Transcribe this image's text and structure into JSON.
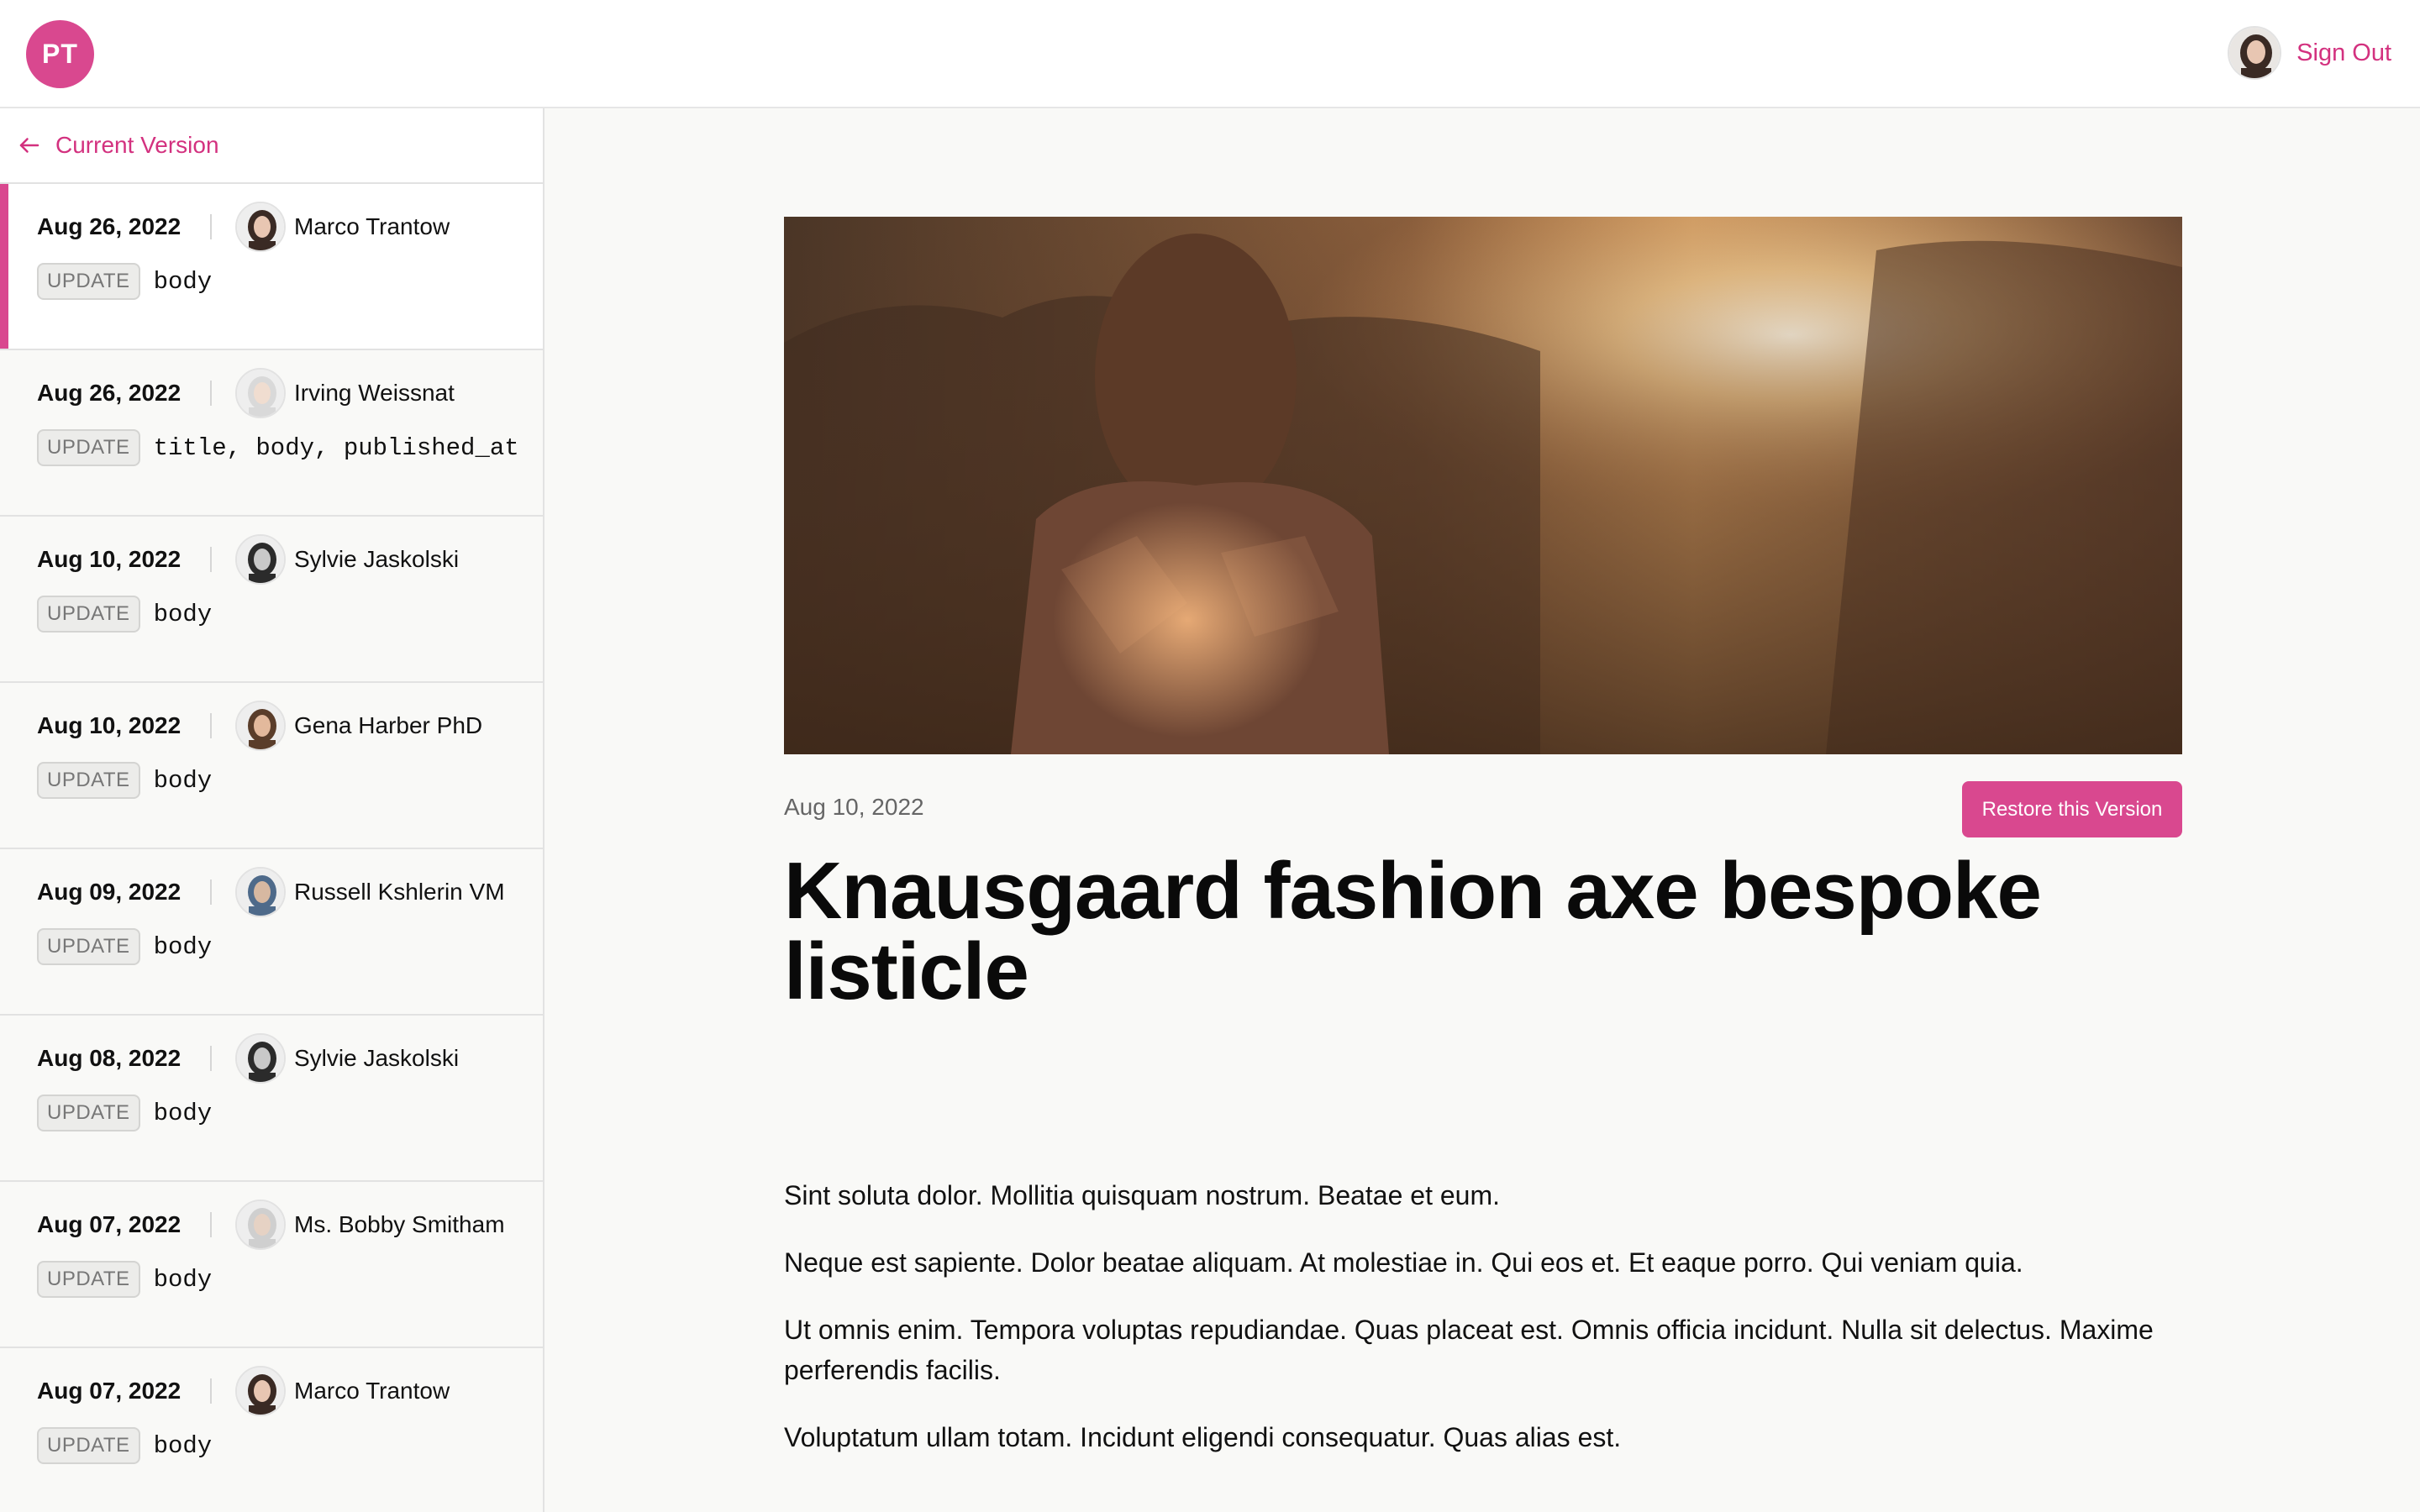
{
  "header": {
    "logo_text": "PT",
    "signout_label": "Sign Out"
  },
  "sidebar": {
    "back_label": "Current Version",
    "versions": [
      {
        "date": "Aug 26, 2022",
        "author": "Marco Trantow",
        "action": "UPDATE",
        "fields": "body",
        "active": true
      },
      {
        "date": "Aug 26, 2022",
        "author": "Irving Weissnat",
        "action": "UPDATE",
        "fields": "title, body, published_at",
        "active": false
      },
      {
        "date": "Aug 10, 2022",
        "author": "Sylvie Jaskolski",
        "action": "UPDATE",
        "fields": "body",
        "active": false
      },
      {
        "date": "Aug 10, 2022",
        "author": "Gena Harber PhD",
        "action": "UPDATE",
        "fields": "body",
        "active": false
      },
      {
        "date": "Aug 09, 2022",
        "author": "Russell Kshlerin VM",
        "action": "UPDATE",
        "fields": "body",
        "active": false
      },
      {
        "date": "Aug 08, 2022",
        "author": "Sylvie Jaskolski",
        "action": "UPDATE",
        "fields": "body",
        "active": false
      },
      {
        "date": "Aug 07, 2022",
        "author": "Ms. Bobby Smitham",
        "action": "UPDATE",
        "fields": "body",
        "active": false
      },
      {
        "date": "Aug 07, 2022",
        "author": "Marco Trantow",
        "action": "UPDATE",
        "fields": "body",
        "active": false
      }
    ]
  },
  "post": {
    "date": "Aug 10, 2022",
    "restore_label": "Restore this Version",
    "title": "Knausgaard fashion axe bespoke listicle",
    "paragraphs": [
      "Sint soluta dolor. Mollitia quisquam nostrum. Beatae et eum.",
      "Neque est sapiente. Dolor beatae aliquam. At molestiae in. Qui eos et. Et eaque porro. Qui veniam quia.",
      "Ut omnis enim. Tempora voluptas repudiandae. Quas placeat est. Omnis officia incidunt. Nulla sit delectus. Maxime perferendis facilis.",
      "Voluptatum ullam totam. Incidunt eligendi consequatur. Quas alias est."
    ]
  },
  "colors": {
    "accent": "#d9488f",
    "link": "#d3317f"
  }
}
